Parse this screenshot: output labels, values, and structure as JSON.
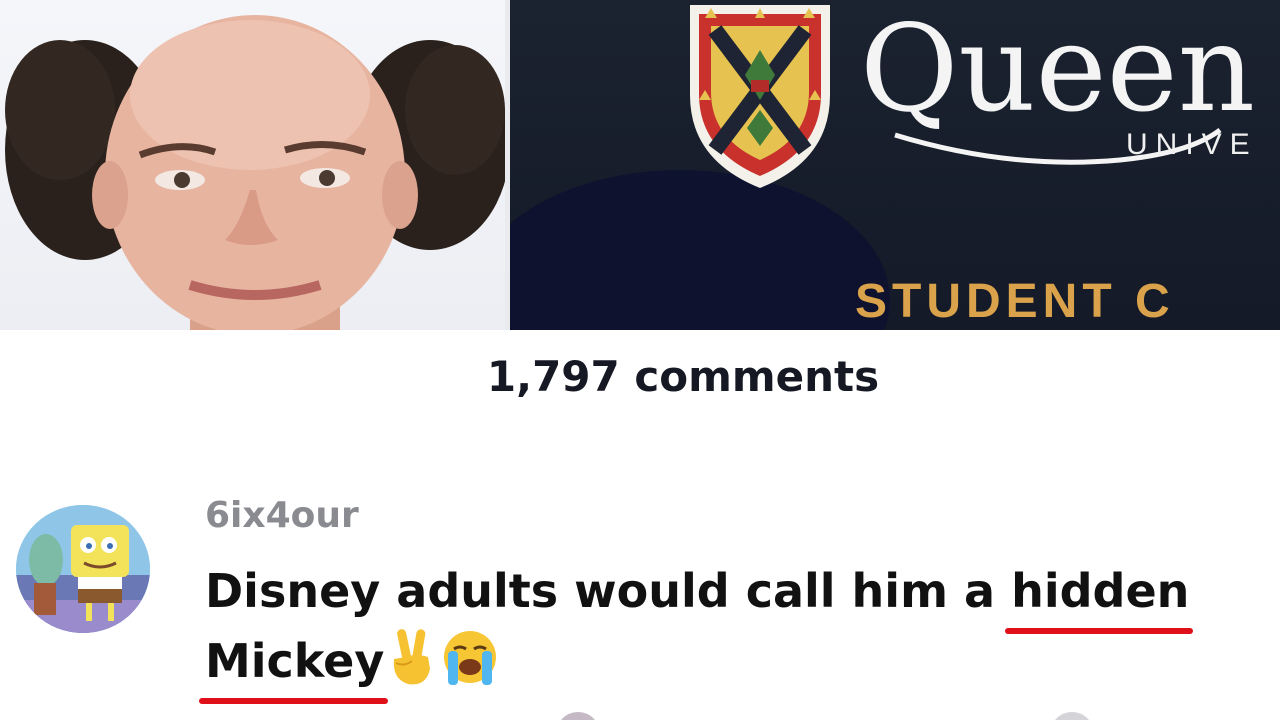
{
  "header": {
    "comments_count": "1,797 comments"
  },
  "media": {
    "card_wordmark": "Queen",
    "card_subtitle": "UNIVE",
    "card_footer": "STUDENT C"
  },
  "comments": [
    {
      "username": "6ix4our",
      "text_before": "Disney adults would call him a ",
      "highlight_1": "hidden",
      "highlight_2": "Mickey",
      "emojis": [
        "victory-hand-icon",
        "loudly-crying-face-icon"
      ]
    }
  ],
  "colors": {
    "text_primary": "#161823",
    "username_gray": "#8a8b91",
    "underline_red": "#e0101a",
    "card_navy": "#1b2230",
    "card_gold": "#d9a24b"
  }
}
